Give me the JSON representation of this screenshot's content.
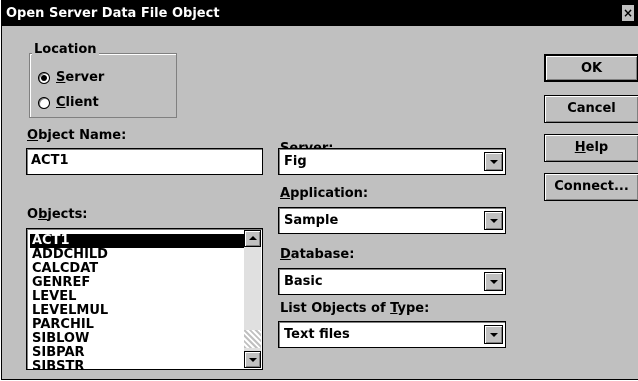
{
  "window": {
    "title": "Open Server Data File Object",
    "close_label": "×"
  },
  "location": {
    "label": "Location",
    "options": [
      {
        "label": "Server",
        "accel": "S",
        "rest": "erver",
        "selected": true
      },
      {
        "label": "Client",
        "accel": "C",
        "rest": "lient",
        "selected": false
      }
    ]
  },
  "object_name": {
    "label_accel": "O",
    "label_rest": "bject Name:",
    "value": "ACT1"
  },
  "objects": {
    "label_pre": "O",
    "label_accel": "b",
    "label_rest": "jects:",
    "items": [
      "ACT1",
      "ADDCHILD",
      "CALCDAT",
      "GENREF",
      "LEVEL",
      "LEVELMUL",
      "PARCHIL",
      "SIBLOW",
      "SIBPAR",
      "SIBSTR"
    ],
    "selected_index": 0
  },
  "server": {
    "label_pre": "Se",
    "label_accel": "r",
    "label_rest": "ver:",
    "value": "Fig"
  },
  "application": {
    "label_accel": "A",
    "label_rest": "pplication:",
    "value": "Sample"
  },
  "database": {
    "label_accel": "D",
    "label_rest": "atabase:",
    "value": "Basic"
  },
  "object_type": {
    "label_pre": "List Objects of ",
    "label_accel": "T",
    "label_rest": "ype:",
    "value": "Text files"
  },
  "buttons": {
    "ok": "OK",
    "cancel": "Cancel",
    "help_accel": "H",
    "help_rest": "elp",
    "connect": "Connect..."
  }
}
